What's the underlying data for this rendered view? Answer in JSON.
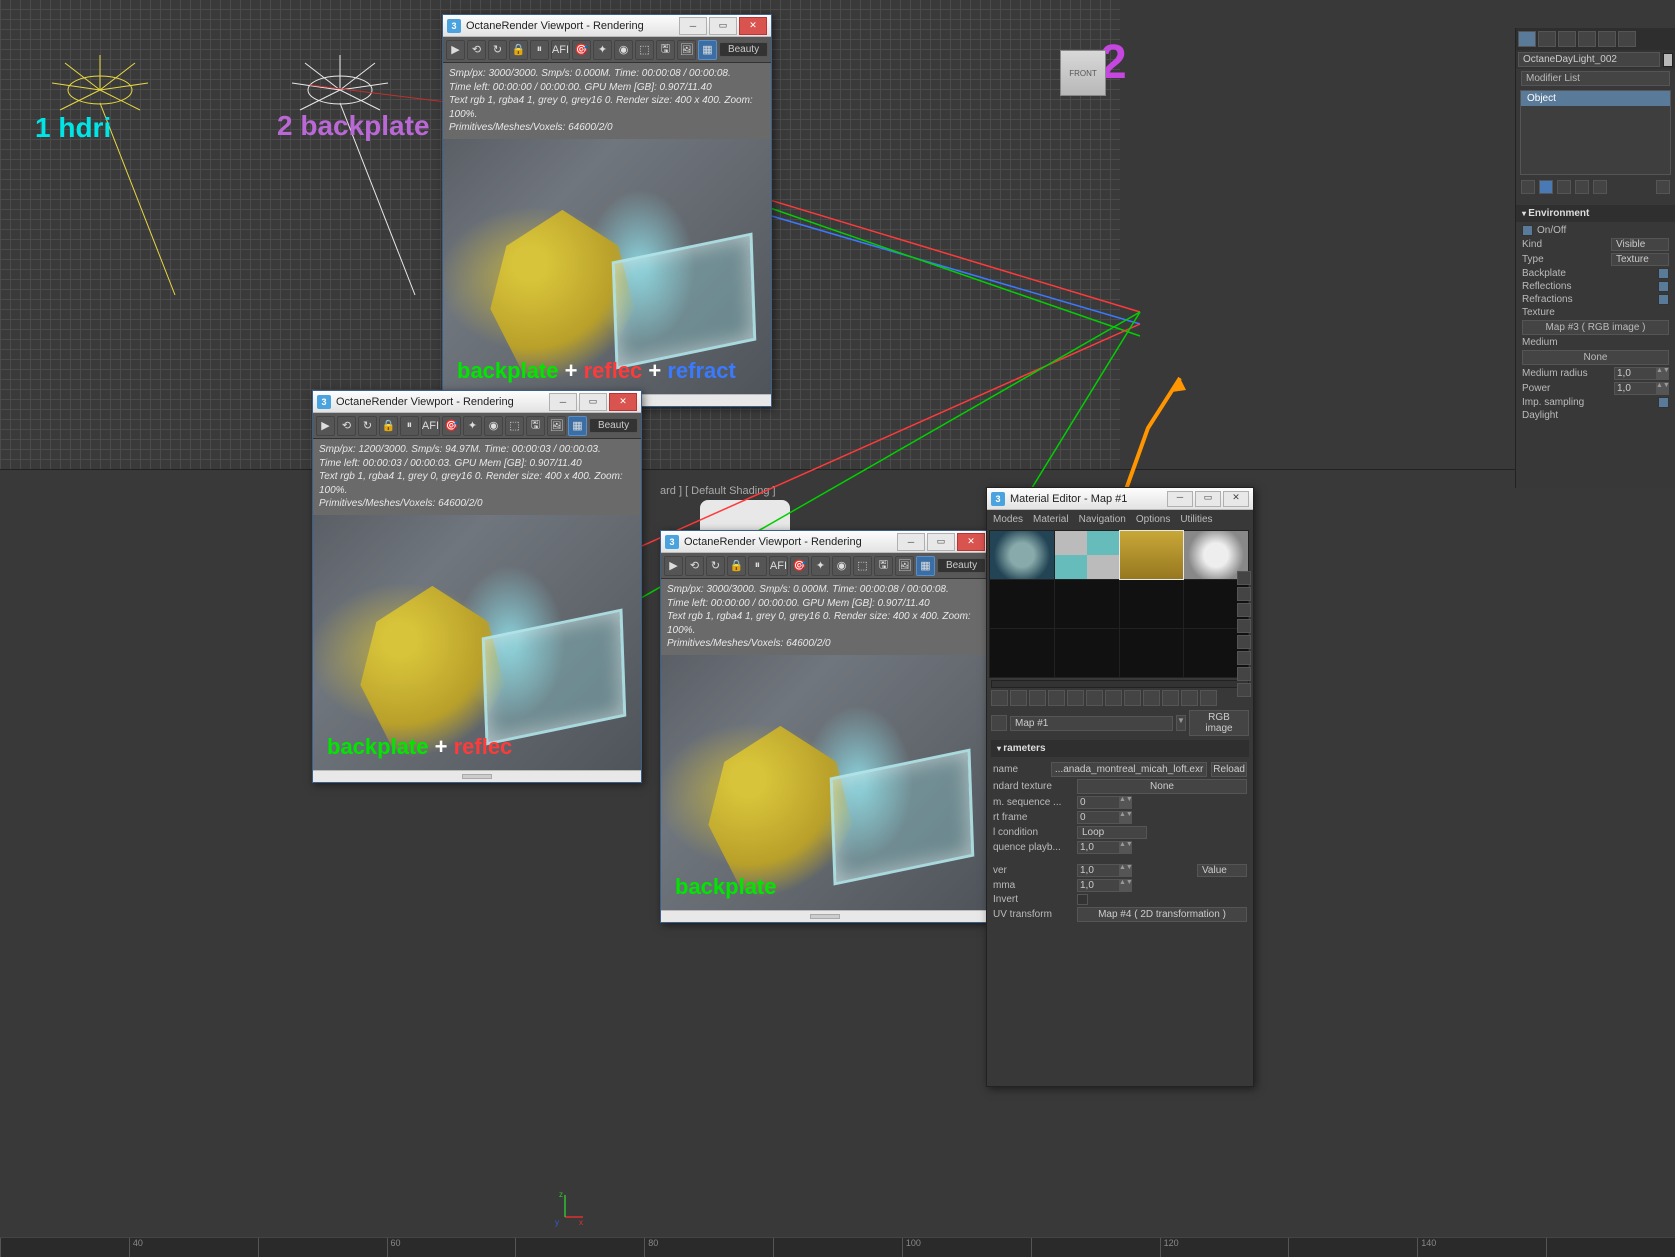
{
  "annotations": {
    "hdri": "1 hdri",
    "backplate_main": "2 backplate",
    "big2": "2"
  },
  "octane_windows": {
    "title": "OctaneRender Viewport - Rendering",
    "beauty": "Beauty",
    "win1": {
      "stats": [
        "Smp/px: 3000/3000.  Smp/s: 0.000M.  Time: 00:00:08 / 00:00:08.",
        "Time left: 00:00:00 / 00:00:00.  GPU Mem [GB]: 0.907/11.40",
        "Text rgb 1, rgba4 1, grey 0, grey16 0.  Render size: 400 x 400.  Zoom: 100%.",
        "Primitives/Meshes/Voxels: 64600/2/0"
      ],
      "overlay": {
        "a": "backplate ",
        "b": "+ ",
        "c": "reflec ",
        "d": "+ ",
        "e": "refract"
      }
    },
    "win2": {
      "stats": [
        "Smp/px: 1200/3000.  Smp/s: 94.97M.  Time: 00:00:03 / 00:00:03.",
        "Time left: 00:00:03 / 00:00:03.  GPU Mem [GB]: 0.907/11.40",
        "Text rgb 1, rgba4 1, grey 0, grey16 0.  Render size: 400 x 400.  Zoom: 100%.",
        "Primitives/Meshes/Voxels: 64600/2/0"
      ],
      "overlay": {
        "a": "backplate ",
        "b": "+ ",
        "c": "reflec"
      }
    },
    "win3": {
      "stats": [
        "Smp/px: 3000/3000.  Smp/s: 0.000M.  Time: 00:00:08 / 00:00:08.",
        "Time left: 00:00:00 / 00:00:00.  GPU Mem [GB]: 0.907/11.40",
        "Text rgb 1, rgba4 1, grey 0, grey16 0.  Render size: 400 x 400.  Zoom: 100%.",
        "Primitives/Meshes/Voxels: 64600/2/0"
      ],
      "overlay": {
        "a": "backplate"
      }
    }
  },
  "command_panel": {
    "object_name": "OctaneDayLight_002",
    "modifier_list": "Modifier List",
    "stack_item": "Object",
    "environment": {
      "header": "Environment",
      "onoff": "On/Off",
      "kind": "Kind",
      "kind_v": "Visible",
      "type": "Type",
      "type_v": "Texture",
      "backplate": "Backplate",
      "reflections": "Reflections",
      "refractions": "Refractions",
      "texture": "Texture",
      "map_btn": "Map #3  ( RGB image )",
      "medium": "Medium",
      "medium_btn": "None",
      "med_radius": "Medium radius",
      "med_radius_v": "1,0",
      "power": "Power",
      "power_v": "1,0",
      "imp": "Imp. sampling",
      "daylight": "Daylight"
    }
  },
  "material_editor": {
    "title": "Material Editor - Map #1",
    "menu": [
      "Modes",
      "Material",
      "Navigation",
      "Options",
      "Utilities"
    ],
    "map_name": "Map #1",
    "map_type": "RGB image",
    "params_header": "rameters",
    "rows": {
      "filename_l": "name",
      "filename_v": "...anada_montreal_micah_loft.exr",
      "reload": "Reload",
      "stdtex_l": "ndard texture",
      "stdtex_v": "None",
      "seq_l": "m. sequence ...",
      "seq_v": "0",
      "start_l": "rt frame",
      "start_v": "0",
      "cond_l": "l condition",
      "cond_v": "Loop",
      "pbspeed_l": "quence playb...",
      "pbspeed_v": "1,0",
      "ver_l": "ver",
      "ver_v": "1,0",
      "ver_mode": "Value",
      "gamma_l": "mma",
      "gamma_v": "1,0",
      "invert_l": "Invert",
      "uvt_l": "UV transform",
      "uvt_v": "Map #4 ( 2D transformation )"
    }
  },
  "viewport_label": "ard ] [ Default Shading ]",
  "ruler": [
    "40",
    "60",
    "80",
    "100",
    "120",
    "140"
  ]
}
